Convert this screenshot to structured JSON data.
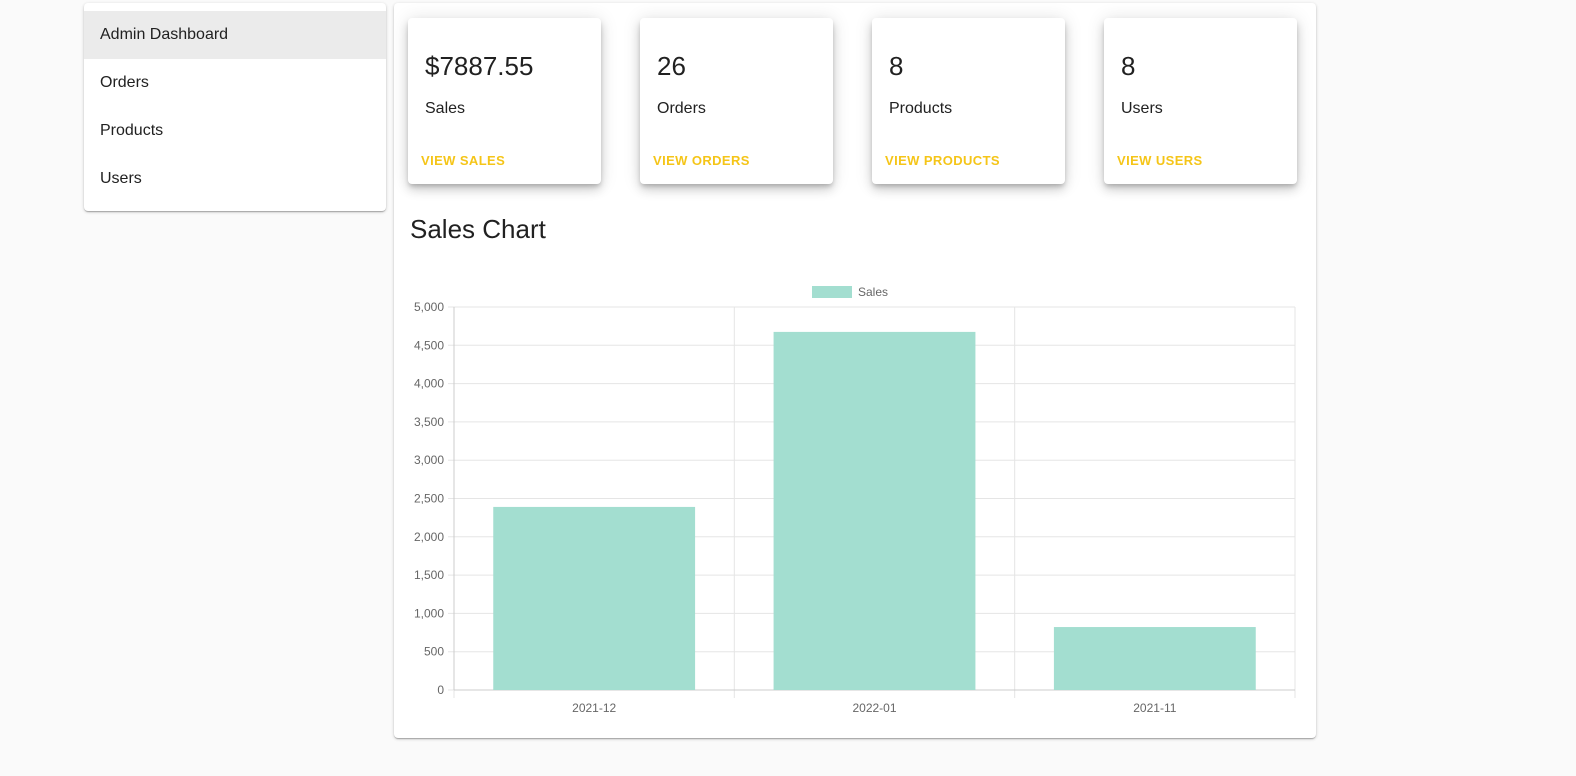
{
  "sidebar": {
    "items": [
      {
        "label": "Admin Dashboard",
        "active": true
      },
      {
        "label": "Orders",
        "active": false
      },
      {
        "label": "Products",
        "active": false
      },
      {
        "label": "Users",
        "active": false
      }
    ]
  },
  "cards": [
    {
      "value": "$7887.55",
      "label": "Sales",
      "action": "VIEW SALES"
    },
    {
      "value": "26",
      "label": "Orders",
      "action": "VIEW ORDERS"
    },
    {
      "value": "8",
      "label": "Products",
      "action": "VIEW PRODUCTS"
    },
    {
      "value": "8",
      "label": "Users",
      "action": "VIEW USERS"
    }
  ],
  "chart_section": {
    "title": "Sales Chart"
  },
  "colors": {
    "accent": "#f5c518",
    "bar_fill": "#a3ded0",
    "active_item_bg": "#ebebeb",
    "grid": "#e5e5e5"
  },
  "chart_data": {
    "type": "bar",
    "categories": [
      "2021-12",
      "2022-01",
      "2021-11"
    ],
    "series": [
      {
        "name": "Sales",
        "values": [
          2390,
          4675,
          822
        ],
        "color": "#a3ded0"
      }
    ],
    "ylim": [
      0,
      5000
    ],
    "yticks": [
      "5,000",
      "4,500",
      "4,000",
      "3,500",
      "3,000",
      "2,500",
      "2,000",
      "1,500",
      "1,000",
      "500",
      "0"
    ],
    "legend": "top-center",
    "grid": true
  }
}
